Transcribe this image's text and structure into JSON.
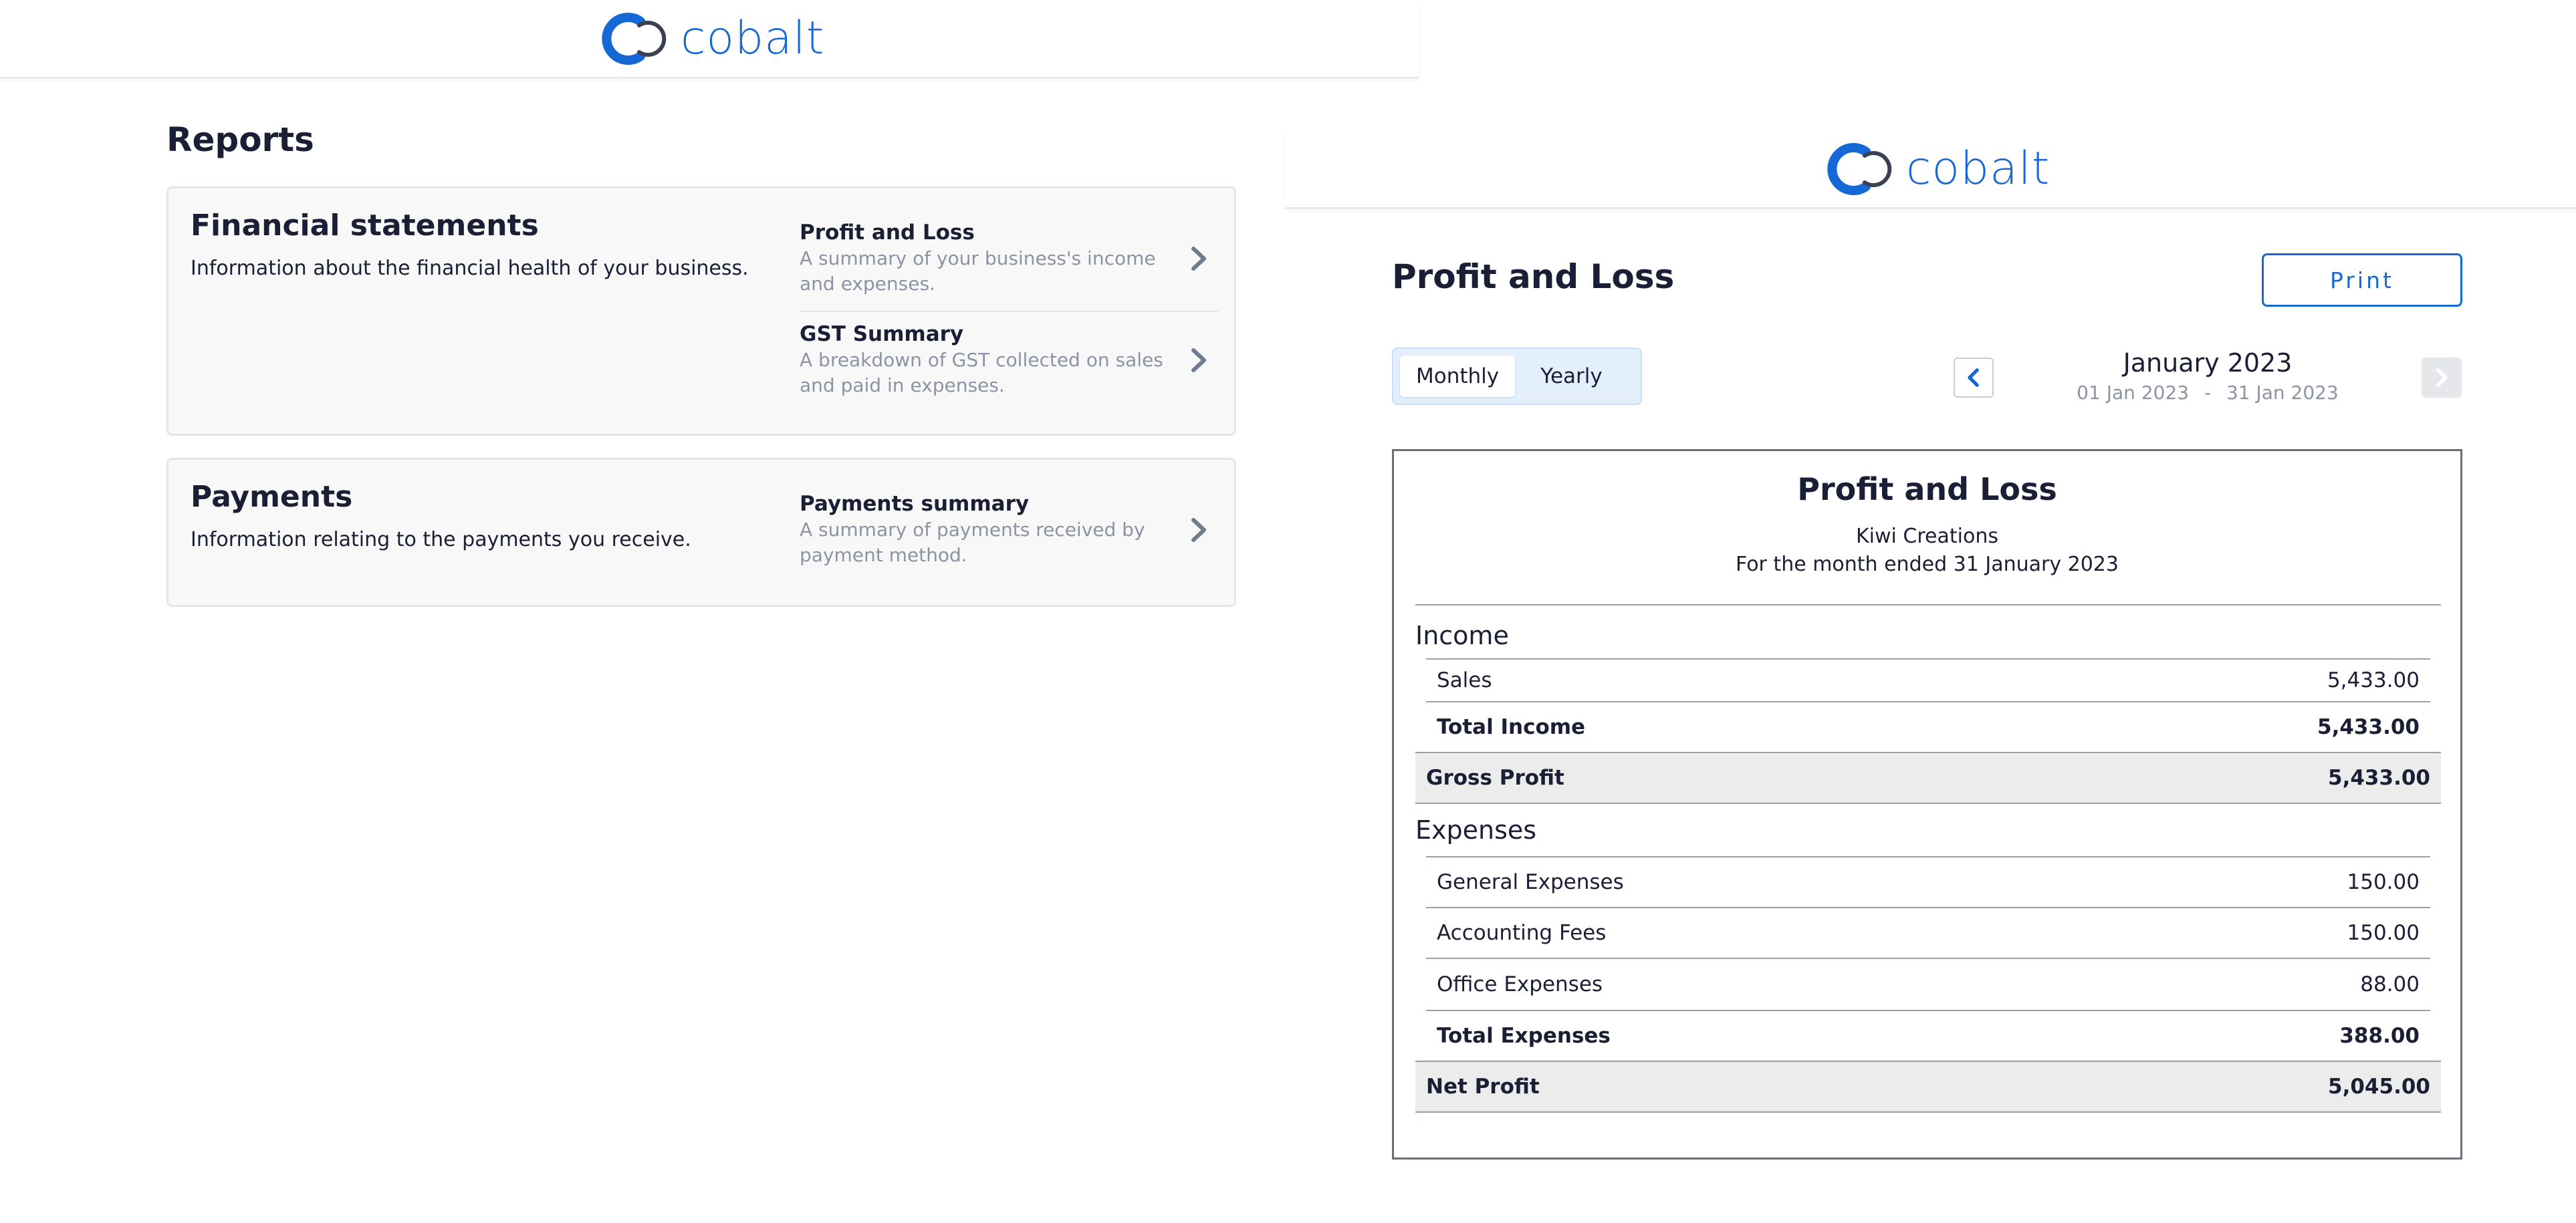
{
  "brand": {
    "name": "cobalt",
    "color": "#1668d6"
  },
  "reports_page": {
    "heading": "Reports",
    "cards": [
      {
        "title": "Financial statements",
        "description": "Information about the financial health of your business.",
        "links": [
          {
            "title": "Profit and Loss",
            "subtitle": "A summary of your business's income and expenses."
          },
          {
            "title": "GST Summary",
            "subtitle": "A breakdown of GST collected on sales and paid in expenses."
          }
        ]
      },
      {
        "title": "Payments",
        "description": "Information relating to the payments you receive.",
        "links": [
          {
            "title": "Payments summary",
            "subtitle": "A summary of payments received by payment method."
          }
        ]
      }
    ]
  },
  "pl_page": {
    "heading": "Profit and Loss",
    "print_label": "Print",
    "period_toggle": {
      "options": [
        "Monthly",
        "Yearly"
      ],
      "selected": "Monthly"
    },
    "period": {
      "title": "January 2023",
      "start": "01 Jan 2023",
      "separator": "-",
      "end": "31 Jan 2023"
    },
    "statement": {
      "title": "Profit and Loss",
      "company": "Kiwi Creations",
      "period_text": "For the month ended 31 January 2023",
      "income": {
        "label": "Income",
        "items": [
          {
            "name": "Sales",
            "amount": "5,433.00"
          }
        ],
        "total_label": "Total Income",
        "total": "5,433.00"
      },
      "gross_profit": {
        "label": "Gross Profit",
        "amount": "5,433.00"
      },
      "expenses": {
        "label": "Expenses",
        "items": [
          {
            "name": "General Expenses",
            "amount": "150.00"
          },
          {
            "name": "Accounting Fees",
            "amount": "150.00"
          },
          {
            "name": "Office Expenses",
            "amount": "88.00"
          }
        ],
        "total_label": "Total Expenses",
        "total": "388.00"
      },
      "net_profit": {
        "label": "Net Profit",
        "amount": "5,045.00"
      }
    }
  }
}
